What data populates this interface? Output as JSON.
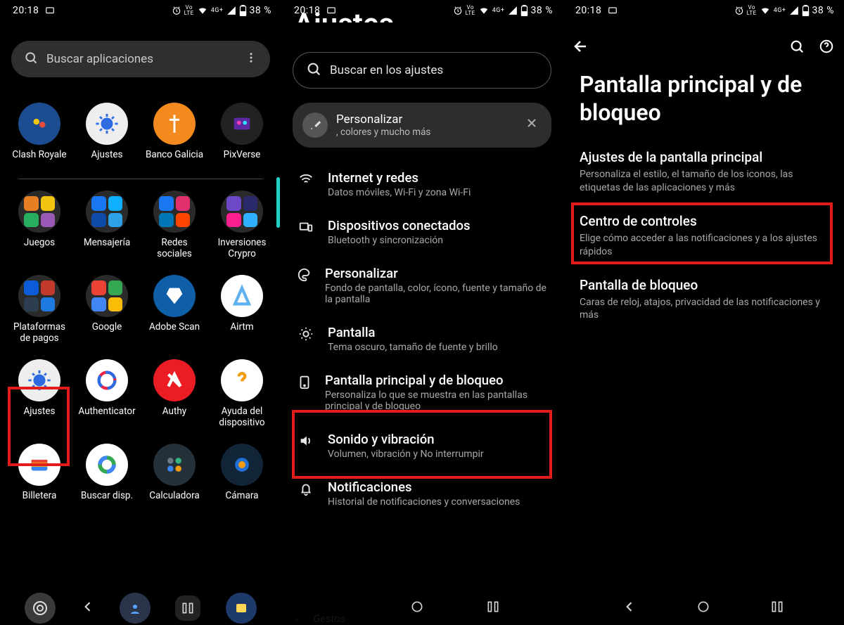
{
  "status": {
    "time": "20:18",
    "battery": "38 %",
    "lte": "LTE",
    "sig": "4G+",
    "volte": "Vo"
  },
  "pane1": {
    "search_placeholder": "Buscar aplicaciones",
    "apps_row1": [
      {
        "label": "Clash Royale",
        "icon_name": "clash-royale-icon",
        "bg": "#1b4c8f"
      },
      {
        "label": "Ajustes",
        "icon_name": "settings-icon",
        "bg": "#eeeeee",
        "fg": "#2c6be0"
      },
      {
        "label": "Banco Galicia",
        "icon_name": "banco-galicia-icon",
        "bg": "#f28a1e"
      },
      {
        "label": "PixVerse",
        "icon_name": "pixverse-icon",
        "bg": "#222"
      }
    ],
    "apps_row2": [
      {
        "label": "Juegos",
        "icon_name": "folder-games-icon",
        "folder": true,
        "minis": [
          "#e67e22",
          "#f1c40f",
          "#27ae60",
          "#9b59b6"
        ]
      },
      {
        "label": "Mensajería",
        "icon_name": "folder-messaging-icon",
        "folder": true,
        "minis": [
          "#1877f2",
          "#0fb0ff",
          "#0e4aa8",
          "#2ea1e8"
        ]
      },
      {
        "label": "Redes sociales",
        "icon_name": "folder-social-icon",
        "folder": true,
        "minis": [
          "#1877f2",
          "#e1306c",
          "#0077b5",
          "#ff4500"
        ]
      },
      {
        "label": "Inversiones Crypro",
        "icon_name": "folder-crypto-icon",
        "folder": true,
        "minis": [
          "#6e49c7",
          "#2a2a6a",
          "#ff1f8e",
          "#2fb1ff"
        ]
      }
    ],
    "apps_row3": [
      {
        "label": "Plataformas de pagos",
        "icon_name": "folder-payments-icon",
        "folder": true,
        "minis": [
          "#0b5cd6",
          "#c0392b",
          "#2c3e50",
          "#1f7ae0"
        ]
      },
      {
        "label": "Google",
        "icon_name": "folder-google-icon",
        "folder": true,
        "minis": [
          "#ea4335",
          "#34a853",
          "#4285f4",
          "#fbbc05"
        ]
      },
      {
        "label": "Adobe Scan",
        "icon_name": "adobe-scan-icon",
        "bg": "#0e5ea8"
      },
      {
        "label": "Airtm",
        "icon_name": "airtm-icon",
        "bg": "#ffffff"
      }
    ],
    "apps_row4": [
      {
        "label": "Ajustes",
        "icon_name": "settings-icon",
        "bg": "#eeeeee",
        "fg": "#2c6be0"
      },
      {
        "label": "Authenticator",
        "icon_name": "authenticator-icon",
        "bg": "#ffffff"
      },
      {
        "label": "Authy",
        "icon_name": "authy-icon",
        "bg": "#ec1c24"
      },
      {
        "label": "Ayuda del dispositivo",
        "icon_name": "device-help-icon",
        "bg": "#ffffff"
      }
    ],
    "apps_row5": [
      {
        "label": "Billetera",
        "icon_name": "wallet-icon",
        "bg": "#ffffff"
      },
      {
        "label": "Buscar disp.",
        "icon_name": "find-device-icon",
        "bg": "#ffffff"
      },
      {
        "label": "Calculadora",
        "icon_name": "calculator-icon",
        "bg": "#24303a"
      },
      {
        "label": "Cámara",
        "icon_name": "camera-icon",
        "bg": "#122438"
      }
    ]
  },
  "pane2": {
    "partial_heading": "Ajustes",
    "search_placeholder": "Buscar en los ajustes",
    "promo_title": "Personalizar",
    "promo_sub": ", colores y mucho más",
    "items": [
      {
        "icon": "wifi",
        "title": "Internet y redes",
        "sub": "Datos móviles, Wi-Fi y zona Wi-Fi"
      },
      {
        "icon": "devices",
        "title": "Dispositivos conectados",
        "sub": "Bluetooth y sincronización"
      },
      {
        "icon": "palette",
        "title": "Personalizar",
        "sub": "Fondo de pantalla, color, ícono, fuente y tamaño de la pantalla"
      },
      {
        "icon": "brightness",
        "title": "Pantalla",
        "sub": "Tema oscuro, tamaño de fuente y brillo"
      },
      {
        "icon": "lock",
        "title": "Pantalla principal y de bloqueo",
        "sub": "Personaliza lo que se muestra en las pantallas principal y de bloqueo"
      },
      {
        "icon": "volume",
        "title": "Sonido y vibración",
        "sub": "Volumen, vibración y No interrumpir"
      },
      {
        "icon": "bell",
        "title": "Notificaciones",
        "sub": "Historial de notificaciones y conversaciones"
      }
    ],
    "cut_item": "Gestos"
  },
  "pane3": {
    "heading": "Pantalla principal y de bloqueo",
    "items": [
      {
        "title": "Ajustes de la pantalla principal",
        "sub": "Personaliza el estilo, el tamaño de los iconos, las etiquetas de las aplicaciones y más"
      },
      {
        "title": "Centro de controles",
        "sub": "Elige cómo acceder a las notificaciones y a los ajustes rápidos"
      },
      {
        "title": "Pantalla de bloqueo",
        "sub": "Caras de reloj, atajos, privacidad de las notificaciones y más"
      }
    ]
  }
}
